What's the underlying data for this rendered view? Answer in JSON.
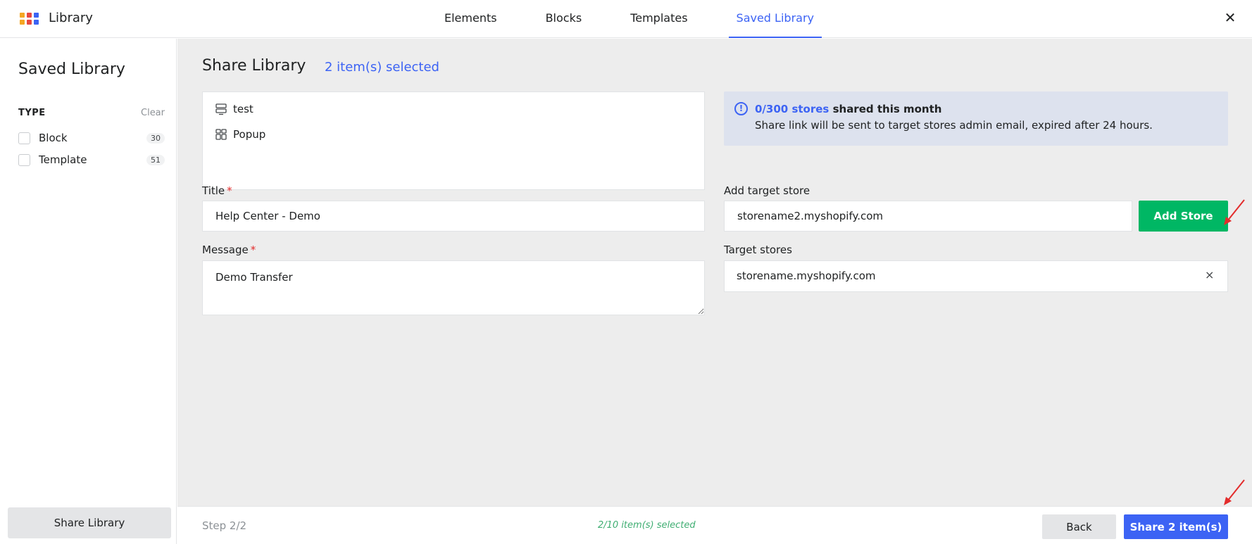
{
  "header": {
    "app_title": "Library",
    "tabs": [
      {
        "label": "Elements",
        "active": false
      },
      {
        "label": "Blocks",
        "active": false
      },
      {
        "label": "Templates",
        "active": false
      },
      {
        "label": "Saved Library",
        "active": true
      }
    ],
    "close_icon": "close-icon"
  },
  "sidebar": {
    "title": "Saved Library",
    "filter_heading": "TYPE",
    "clear_label": "Clear",
    "filters": [
      {
        "label": "Block",
        "count": "30",
        "checked": false
      },
      {
        "label": "Template",
        "count": "51",
        "checked": false
      }
    ],
    "share_button": "Share Library"
  },
  "main": {
    "title": "Share Library",
    "selected_text": "2 item(s) selected",
    "items": [
      {
        "name": "test",
        "icon": "section-icon"
      },
      {
        "name": "Popup",
        "icon": "popup-icon"
      }
    ],
    "info": {
      "highlight": "0/300 stores",
      "headline_rest": " shared this month",
      "description": "Share link will be sent to target stores admin email, expired after 24 hours."
    },
    "title_label": "Title",
    "title_value": "Help Center - Demo",
    "message_label": "Message",
    "message_value": "Demo Transfer",
    "add_target_label": "Add target store",
    "add_target_value": "storename2.myshopify.com",
    "add_store_button": "Add Store",
    "target_stores_label": "Target stores",
    "target_stores": [
      "storename.myshopify.com"
    ],
    "required_mark": "*",
    "remove_symbol": "×"
  },
  "footer": {
    "step": "Step 2/2",
    "selected": "2/10 item(s) selected",
    "back_button": "Back",
    "share_button": "Share 2 item(s)"
  },
  "colors": {
    "accent": "#3c63f4",
    "success": "#00b764",
    "annotation_arrow": "#e32c2c"
  }
}
